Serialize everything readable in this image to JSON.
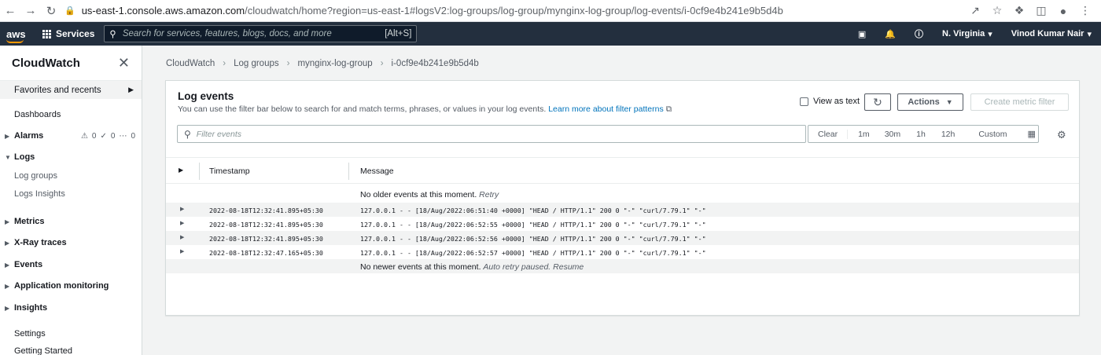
{
  "browser": {
    "url_host": "us-east-1.console.aws.amazon.com",
    "url_path": "/cloudwatch/home?region=us-east-1#logsV2:log-groups/log-group/mynginx-log-group/log-events/i-0cf9e4b241e9b5d4b"
  },
  "aws_nav": {
    "logo": "aws",
    "services_label": "Services",
    "search_placeholder": "Search for services, features, blogs, docs, and more",
    "search_shortcut": "[Alt+S]",
    "region": "N. Virginia",
    "user": "Vinod Kumar Nair"
  },
  "sidebar": {
    "title": "CloudWatch",
    "favorites": "Favorites and recents",
    "items": [
      {
        "label": "Dashboards"
      },
      {
        "label": "Alarms"
      },
      {
        "label": "Logs"
      },
      {
        "label": "Log groups"
      },
      {
        "label": "Logs Insights"
      },
      {
        "label": "Metrics"
      },
      {
        "label": "X-Ray traces"
      },
      {
        "label": "Events"
      },
      {
        "label": "Application monitoring"
      },
      {
        "label": "Insights"
      },
      {
        "label": "Settings"
      },
      {
        "label": "Getting Started"
      }
    ],
    "alarm_counts": [
      "0",
      "0",
      "0"
    ]
  },
  "breadcrumb": [
    "CloudWatch",
    "Log groups",
    "mynginx-log-group",
    "i-0cf9e4b241e9b5d4b"
  ],
  "panel": {
    "title": "Log events",
    "description": "You can use the filter bar below to search for and match terms, phrases, or values in your log events.",
    "learn_more": "Learn more about filter patterns",
    "view_as_text": "View as text",
    "actions_label": "Actions",
    "create_metric_filter": "Create metric filter",
    "filter_placeholder": "Filter events",
    "time_options": [
      "Clear",
      "1m",
      "30m",
      "1h",
      "12h",
      "Custom"
    ]
  },
  "table": {
    "col_timestamp": "Timestamp",
    "col_message": "Message",
    "older_notice": "No older events at this moment.",
    "older_retry": "Retry",
    "newer_notice": "No newer events at this moment.",
    "newer_paused": "Auto retry paused.",
    "newer_resume": "Resume",
    "rows": [
      {
        "timestamp": "2022-08-18T12:32:41.895+05:30",
        "message": "127.0.0.1 - - [18/Aug/2022:06:51:40 +0000] \"HEAD / HTTP/1.1\" 200 0 \"-\" \"curl/7.79.1\" \"-\""
      },
      {
        "timestamp": "2022-08-18T12:32:41.895+05:30",
        "message": "127.0.0.1 - - [18/Aug/2022:06:52:55 +0000] \"HEAD / HTTP/1.1\" 200 0 \"-\" \"curl/7.79.1\" \"-\""
      },
      {
        "timestamp": "2022-08-18T12:32:41.895+05:30",
        "message": "127.0.0.1 - - [18/Aug/2022:06:52:56 +0000] \"HEAD / HTTP/1.1\" 200 0 \"-\" \"curl/7.79.1\" \"-\""
      },
      {
        "timestamp": "2022-08-18T12:32:47.165+05:30",
        "message": "127.0.0.1 - - [18/Aug/2022:06:52:57 +0000] \"HEAD / HTTP/1.1\" 200 0 \"-\" \"curl/7.79.1\" \"-\""
      }
    ]
  }
}
